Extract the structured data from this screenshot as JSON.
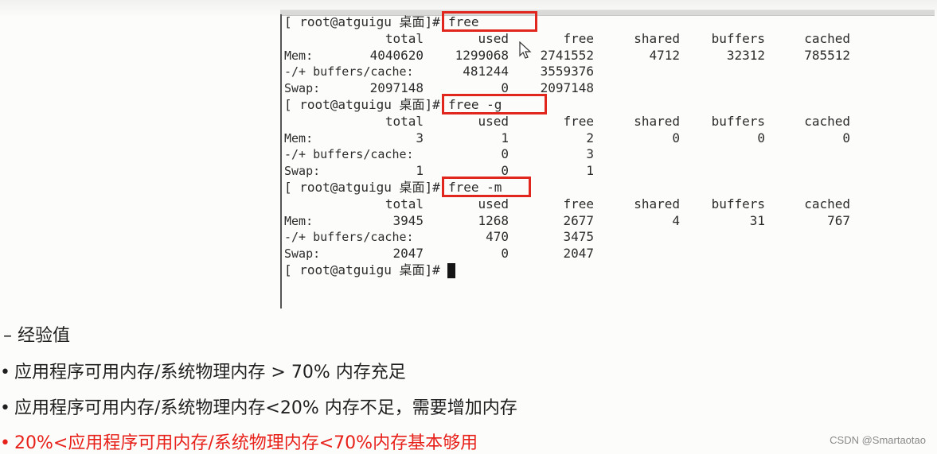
{
  "terminal": {
    "prompt": "[ root@atguigu 桌面]#",
    "columns": [
      "total",
      "used",
      "free",
      "shared",
      "buffers",
      "cached"
    ],
    "row_labels": {
      "mem": "Mem:",
      "buffers": "-/+ buffers/cache:",
      "swap": "Swap:"
    },
    "blocks": [
      {
        "command": "free",
        "mem": [
          "4040620",
          "1299068",
          "2741552",
          "4712",
          "32312",
          "785512"
        ],
        "buffers": [
          "",
          "481244",
          "3559376"
        ],
        "swap": [
          "2097148",
          "0",
          "2097148"
        ]
      },
      {
        "command": "free -g",
        "mem": [
          "3",
          "1",
          "2",
          "0",
          "0",
          "0"
        ],
        "buffers": [
          "",
          "0",
          "3"
        ],
        "swap": [
          "1",
          "0",
          "1"
        ]
      },
      {
        "command": "free -m",
        "mem": [
          "3945",
          "1268",
          "2677",
          "4",
          "31",
          "767"
        ],
        "buffers": [
          "",
          "470",
          "3475"
        ],
        "swap": [
          "2047",
          "0",
          "2047"
        ]
      }
    ],
    "highlight_color": "#e0261d"
  },
  "notes": {
    "heading": "–  经验值",
    "items": [
      {
        "bullet": "•",
        "text": "应用程序可用内存/系统物理内存 > 70% 内存充足",
        "color": "#1f1f1f"
      },
      {
        "bullet": "•",
        "text": "应用程序可用内存/系统物理内存<20% 内存不足，需要增加内存",
        "color": "#1f1f1f"
      },
      {
        "bullet": "•",
        "text": "20%<应用程序可用内存/系统物理内存<70%内存基本够用",
        "color": "#e8201a"
      }
    ]
  },
  "watermark": "CSDN @Smartaotao"
}
